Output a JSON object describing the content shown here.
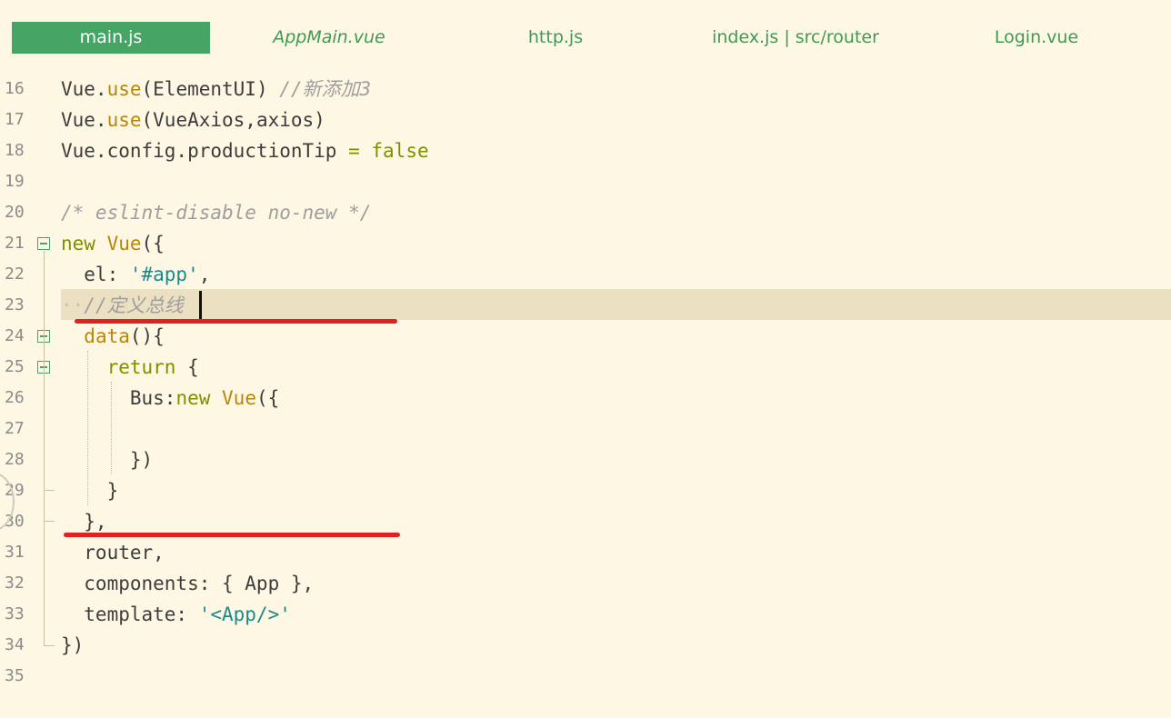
{
  "tabs": [
    {
      "label": "main.js",
      "active": true
    },
    {
      "label": "AppMain.vue",
      "active": false
    },
    {
      "label": "http.js",
      "active": false
    },
    {
      "label": "index.js | src/router",
      "active": false
    },
    {
      "label": "Login.vue",
      "active": false
    }
  ],
  "editor": {
    "current_line": "23",
    "lines": [
      {
        "num": "16",
        "code": "Vue.use(ElementUI) //新添加3"
      },
      {
        "num": "17",
        "code": "Vue.use(VueAxios,axios)"
      },
      {
        "num": "18",
        "code": "Vue.config.productionTip = false"
      },
      {
        "num": "19",
        "code": ""
      },
      {
        "num": "20",
        "code": "/* eslint-disable no-new */"
      },
      {
        "num": "21",
        "code": "new Vue({"
      },
      {
        "num": "22",
        "code": "  el: '#app',"
      },
      {
        "num": "23",
        "code": "  //定义总线"
      },
      {
        "num": "24",
        "code": "  data(){"
      },
      {
        "num": "25",
        "code": "    return {"
      },
      {
        "num": "26",
        "code": "      Bus:new Vue({"
      },
      {
        "num": "27",
        "code": ""
      },
      {
        "num": "28",
        "code": "      })"
      },
      {
        "num": "29",
        "code": "    }"
      },
      {
        "num": "30",
        "code": "  },"
      },
      {
        "num": "31",
        "code": "  router,"
      },
      {
        "num": "32",
        "code": "  components: { App },"
      },
      {
        "num": "33",
        "code": "  template: '<App/>'"
      },
      {
        "num": "34",
        "code": "})"
      },
      {
        "num": "35",
        "code": ""
      }
    ]
  },
  "colors": {
    "background": "#fdf7e4",
    "active_tab": "#45a564",
    "tab_text": "#3f9a56",
    "keyword": "#7e8f00",
    "function": "#b8860b",
    "string": "#1c8a8a",
    "comment": "#9e9e9e",
    "current_line": "#ece0c3",
    "annotation": "#dd2222"
  },
  "icons": [
    "fold-collapse-icon"
  ]
}
